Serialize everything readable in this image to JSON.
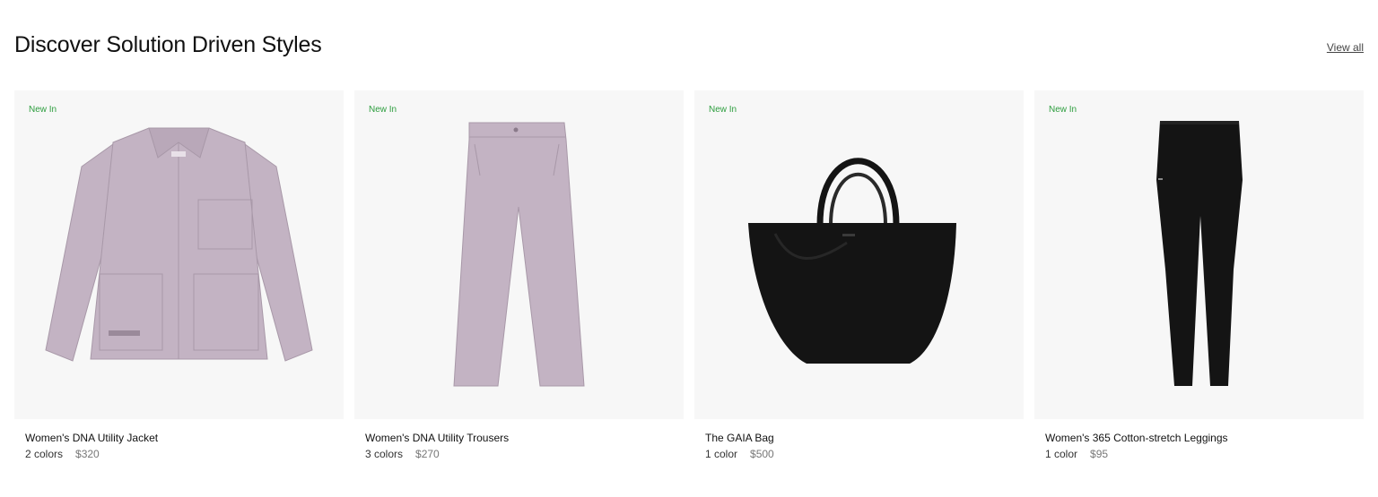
{
  "section": {
    "title": "Discover Solution Driven Styles",
    "view_all": "View all"
  },
  "products": [
    {
      "badge": "New In",
      "name": "Women's DNA Utility Jacket",
      "colors": "2 colors",
      "price": "$320",
      "image_icon": "jacket-icon",
      "color": "#c3b3c3"
    },
    {
      "badge": "New In",
      "name": "Women's DNA Utility Trousers",
      "colors": "3 colors",
      "price": "$270",
      "image_icon": "trousers-icon",
      "color": "#c3b3c3"
    },
    {
      "badge": "New In",
      "name": "The GAIA Bag",
      "colors": "1 color",
      "price": "$500",
      "image_icon": "tote-bag-icon",
      "color": "#141414"
    },
    {
      "badge": "New In",
      "name": "Women's 365 Cotton-stretch Leggings",
      "colors": "1 color",
      "price": "$95",
      "image_icon": "leggings-icon",
      "color": "#141414"
    }
  ]
}
